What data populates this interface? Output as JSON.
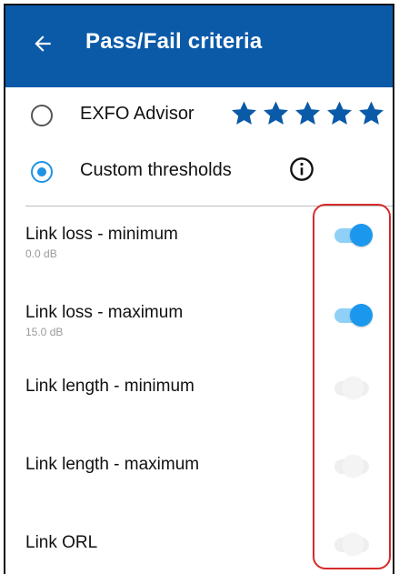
{
  "appbar": {
    "title": "Pass/Fail criteria",
    "back_icon": "arrow-left-icon",
    "background": "#0a5aa8"
  },
  "options": [
    {
      "label": "EXFO Advisor",
      "selected": false,
      "rating": 5,
      "icon": "star-icon"
    },
    {
      "label": "Custom thresholds",
      "selected": true,
      "icon": "info-icon"
    }
  ],
  "criteria": [
    {
      "label": "Link loss - minimum",
      "value": "0.0 dB",
      "enabled": true
    },
    {
      "label": "Link loss - maximum",
      "value": "15.0 dB",
      "enabled": true
    },
    {
      "label": "Link length - minimum",
      "value": "",
      "enabled": false
    },
    {
      "label": "Link length - maximum",
      "value": "",
      "enabled": false
    },
    {
      "label": "Link ORL",
      "value": "",
      "enabled": false
    }
  ],
  "colors": {
    "accent": "#1f93e6",
    "star": "#0a5aa8",
    "highlight": "#d62b2b"
  }
}
